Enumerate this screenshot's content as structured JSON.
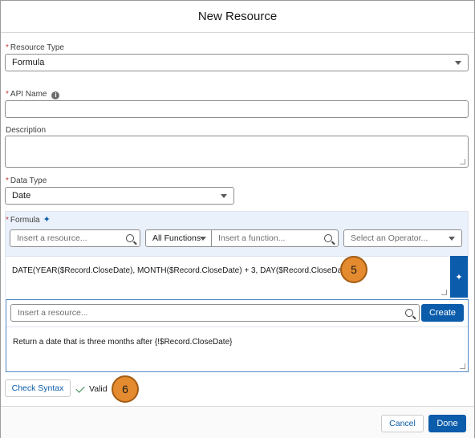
{
  "header": {
    "title": "New Resource"
  },
  "resource_type": {
    "label": "Resource Type",
    "value": "Formula"
  },
  "api_name": {
    "label": "API Name",
    "value": ""
  },
  "description": {
    "label": "Description",
    "value": ""
  },
  "data_type": {
    "label": "Data Type",
    "value": "Date"
  },
  "formula": {
    "label": "Formula",
    "resource_search_placeholder": "Insert a resource...",
    "function_filter": "All Functions",
    "function_search_placeholder": "Insert a function...",
    "operator_placeholder": "Select an Operator...",
    "expression": "DATE(YEAR($Record.CloseDate), MONTH($Record.CloseDate) + 3, DAY($Record.CloseDate))"
  },
  "assistant": {
    "resource_search_placeholder": "Insert a resource...",
    "create_label": "Create",
    "prompt_text": "Return a date that is three months after {!$Record.CloseDate}"
  },
  "callouts": {
    "first": "5",
    "second": "6"
  },
  "syntax": {
    "check_label": "Check Syntax",
    "status": "Valid"
  },
  "footer": {
    "cancel_label": "Cancel",
    "done_label": "Done"
  },
  "colors": {
    "brand": "#0b5cab",
    "required": "#c23934",
    "callout": "#e48a2f",
    "valid": "#2e844a"
  }
}
